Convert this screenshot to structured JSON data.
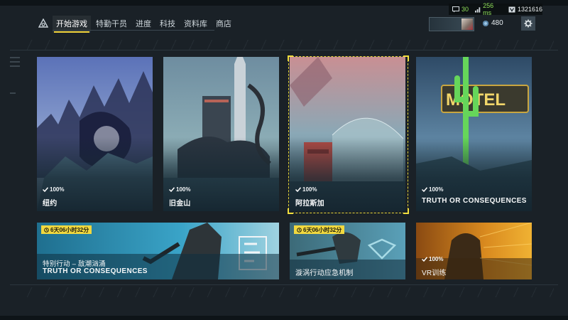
{
  "nav": {
    "items": [
      {
        "label": "开始游戏",
        "active": true
      },
      {
        "label": "特勤干员",
        "active": false
      },
      {
        "label": "进度",
        "active": false
      },
      {
        "label": "科技",
        "active": false
      },
      {
        "label": "资料库",
        "active": false
      },
      {
        "label": "商店",
        "active": false
      }
    ]
  },
  "stats": {
    "players_label": "30",
    "ping_label": "256 ms",
    "id_label": "1321616"
  },
  "profile": {
    "currency_value": "480"
  },
  "cards": [
    {
      "name": "纽约",
      "progress": "100%"
    },
    {
      "name": "旧金山",
      "progress": "100%"
    },
    {
      "name": "阿拉斯加",
      "progress": "100%",
      "selected": true
    },
    {
      "name": "TRUTH OR CONSEQUENCES",
      "progress": "100%",
      "sign_text": "MOTEL"
    }
  ],
  "events": [
    {
      "timer": "6天06小时32分",
      "subtitle": "特别行动 – 敌潮汹涌",
      "title": "TRUTH OR CONSEQUENCES"
    },
    {
      "timer": "6天06小时32分",
      "title": "漩涡行动应急机制"
    },
    {
      "progress": "100%",
      "title": "VR训练"
    }
  ],
  "colors": {
    "accent": "#f2d43b",
    "background": "#1a2127",
    "green_value": "#8fe05a"
  }
}
